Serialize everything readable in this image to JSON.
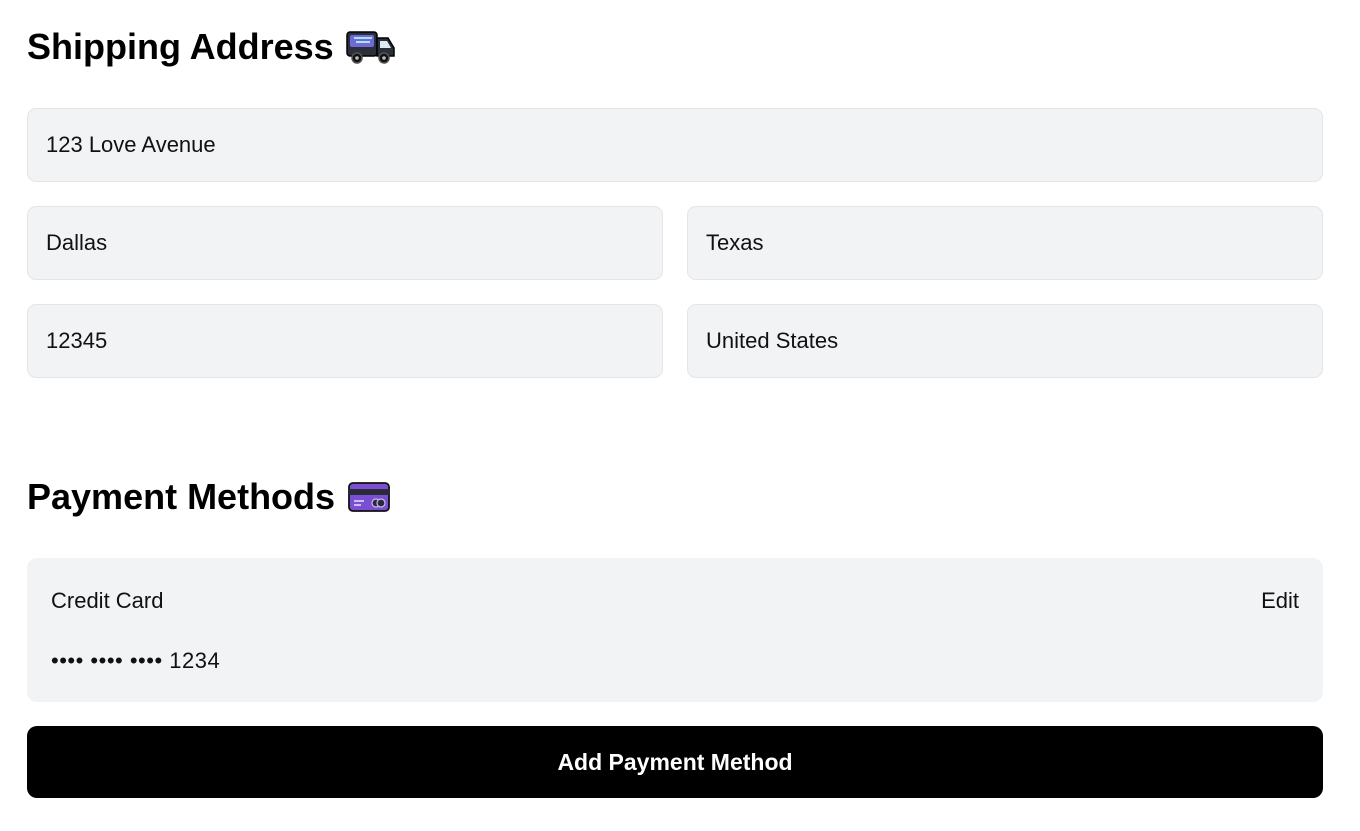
{
  "shipping": {
    "title": "Shipping Address",
    "icon": "delivery-truck-icon",
    "fields": {
      "street": "123 Love Avenue",
      "city": "Dallas",
      "state": "Texas",
      "zip": "12345",
      "country": "United States"
    }
  },
  "payment": {
    "title": "Payment Methods",
    "icon": "credit-card-icon",
    "card": {
      "type": "Credit Card",
      "edit_label": "Edit",
      "number_masked": "•••• •••• •••• 1234"
    },
    "add_button_label": "Add Payment Method"
  },
  "colors": {
    "field_bg": "#f2f3f5",
    "button_bg": "#000000",
    "button_text": "#ffffff"
  }
}
